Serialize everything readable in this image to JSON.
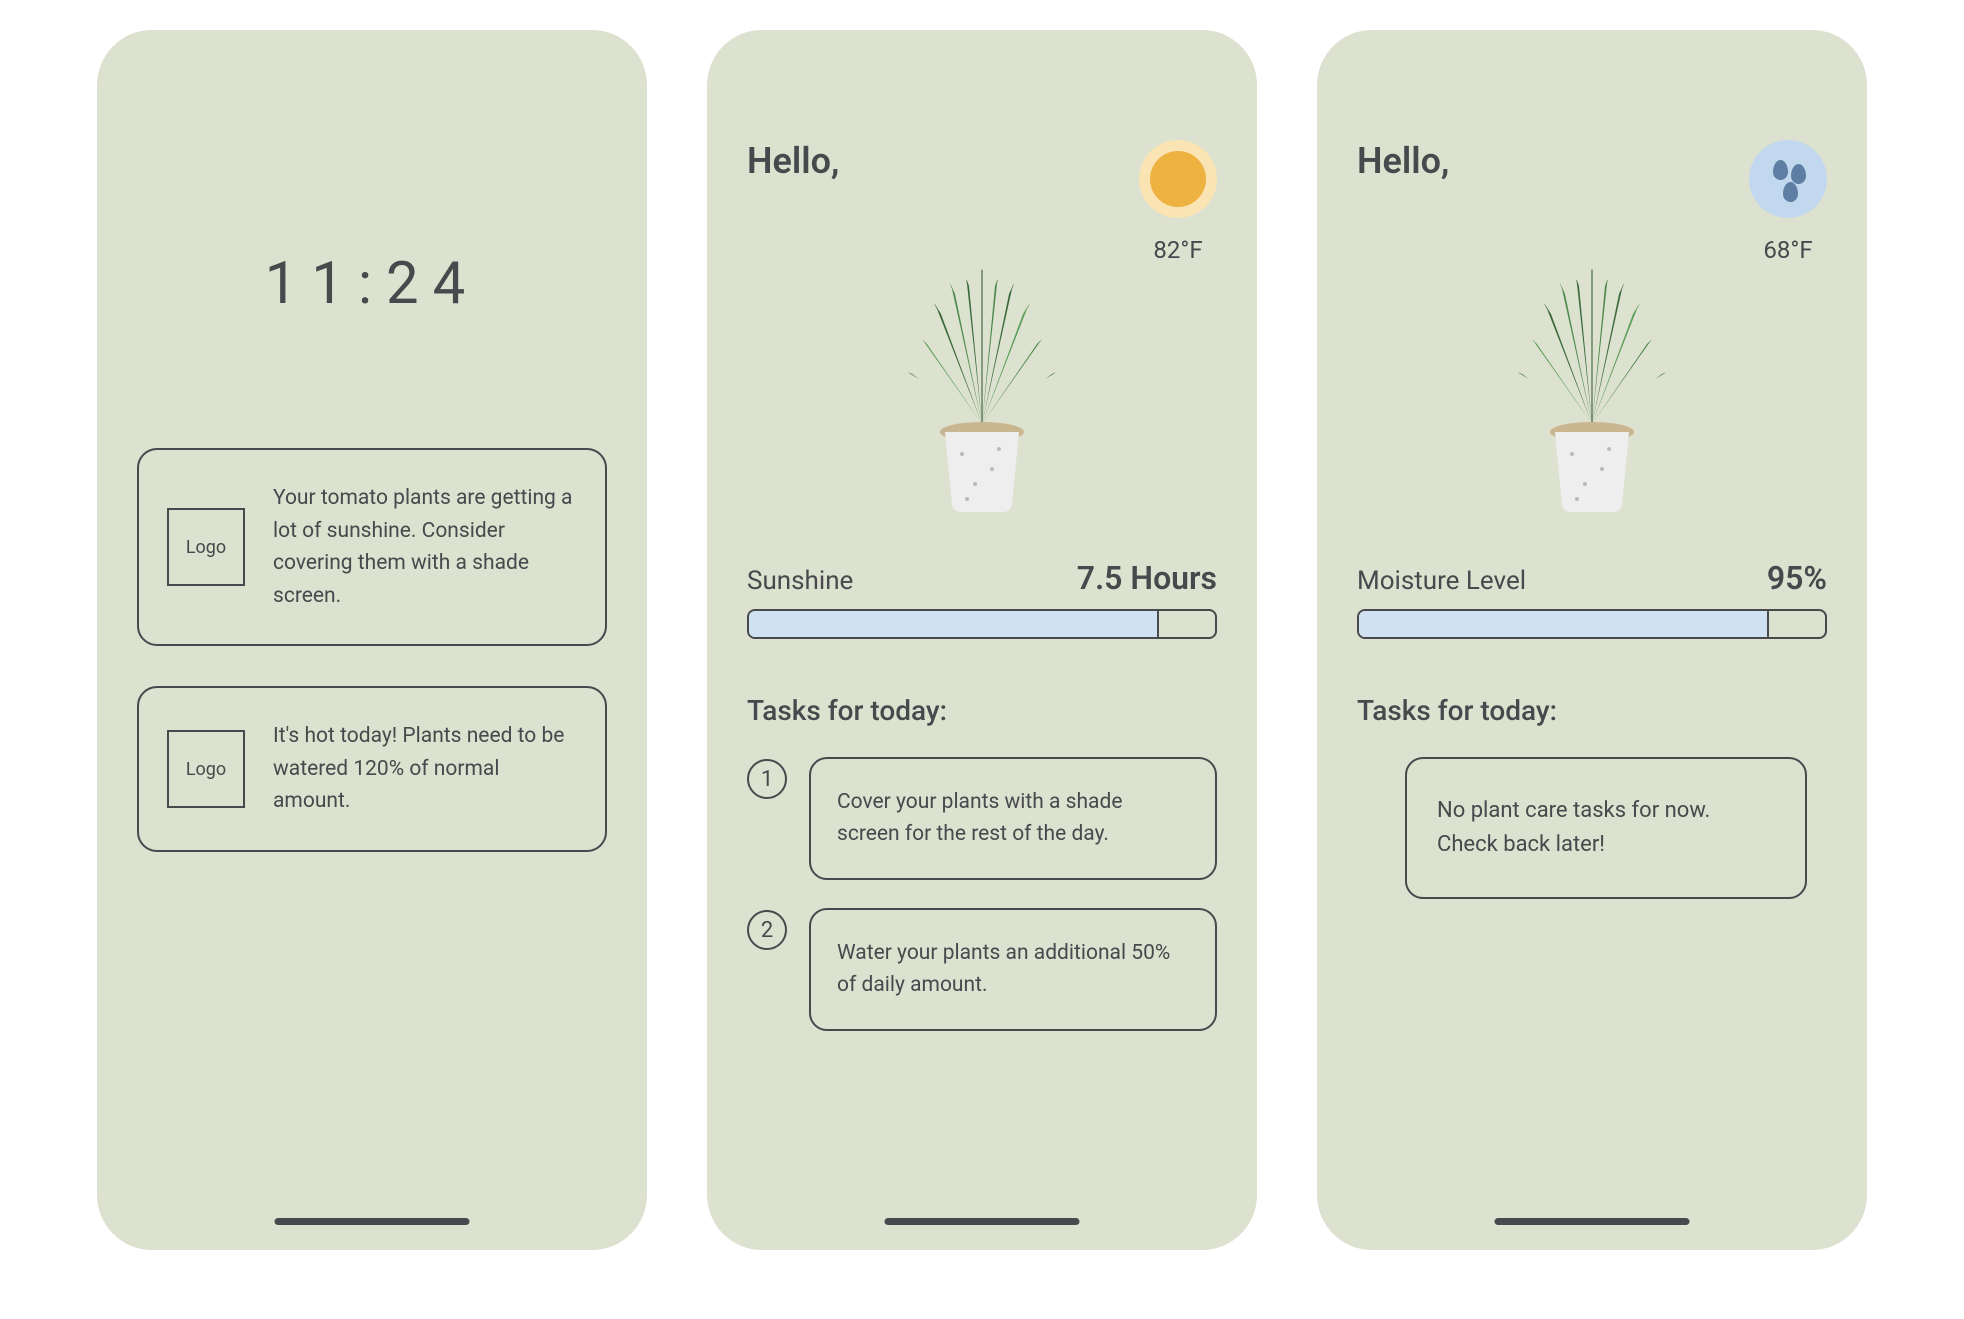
{
  "screen1": {
    "clock": "11:24",
    "logo_label": "Logo",
    "notifications": [
      "Your tomato plants are getting a lot of sunshine. Consider covering them with a shade screen.",
      "It's hot today! Plants need to be watered 120% of normal amount."
    ]
  },
  "screen2": {
    "greeting": "Hello,",
    "temperature": "82°F",
    "metric_label": "Sunshine",
    "metric_value": "7.5 Hours",
    "progress_pct": 88,
    "tasks_title": "Tasks for today:",
    "tasks": [
      "Cover your plants with a shade screen for the rest of the day.",
      "Water your plants an additional 50% of daily amount."
    ]
  },
  "screen3": {
    "greeting": "Hello,",
    "temperature": "68°F",
    "metric_label": "Moisture Level",
    "metric_value": "95%",
    "progress_pct": 88,
    "tasks_title": "Tasks for today:",
    "empty_tasks": "No plant care tasks for now. Check back later!"
  }
}
